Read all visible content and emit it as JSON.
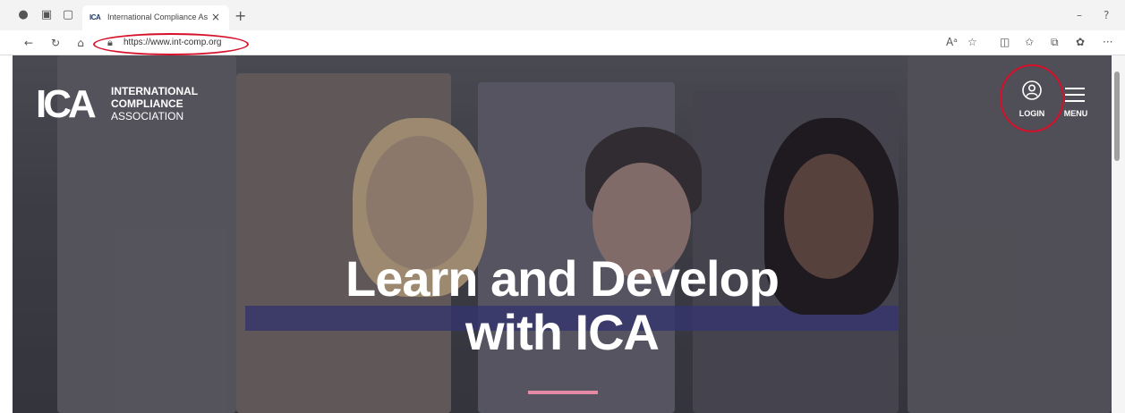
{
  "browser": {
    "tab": {
      "favicon_text": "ICA",
      "title": "International Compliance Associ",
      "close": "×"
    },
    "new_tab": "+",
    "url": "https://www.int-comp.org",
    "window_controls": {
      "minimize": "–",
      "help": "?"
    },
    "toolbar_icons": [
      "read-aloud-icon",
      "favorite-icon",
      "split-screen-icon",
      "favorites-icon",
      "collections-icon",
      "extensions-icon",
      "more-icon"
    ]
  },
  "site": {
    "logo": {
      "mark": "ICA",
      "line1": "INTERNATIONAL",
      "line2": "COMPLIANCE",
      "line3": "ASSOCIATION"
    },
    "login_label": "LOGIN",
    "menu_label": "MENU",
    "headline_line1": "Learn and Develop",
    "headline_line2": "with ICA"
  },
  "colors": {
    "annotation_red": "#d6102a",
    "accent_pink": "#e48aa4"
  }
}
